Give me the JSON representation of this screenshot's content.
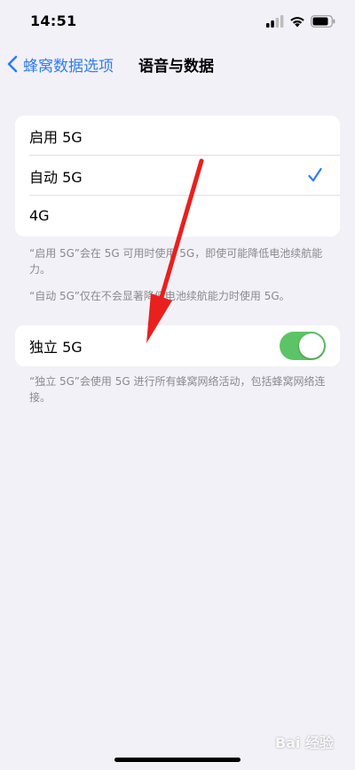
{
  "status_bar": {
    "time": "14:51"
  },
  "nav": {
    "back_label": "蜂窝数据选项",
    "title": "语音与数据"
  },
  "options": {
    "items": [
      {
        "label": "启用 5G",
        "selected": false
      },
      {
        "label": "自动 5G",
        "selected": true
      },
      {
        "label": "4G",
        "selected": false
      }
    ],
    "footnote_1": "“启用 5G”会在 5G 可用时使用 5G，即使可能降低电池续航能力。",
    "footnote_2": "“自动 5G”仅在不会显著降低电池续航能力时使用 5G。"
  },
  "standalone": {
    "label": "独立 5G",
    "enabled": true,
    "footnote": "“独立 5G”会使用 5G 进行所有蜂窝网络活动，包括蜂窝网络连接。"
  },
  "colors": {
    "accent": "#2f7cf6",
    "toggle_on": "#5dc466",
    "annotation_arrow": "#e8201e"
  },
  "watermark": "Bai 经验"
}
